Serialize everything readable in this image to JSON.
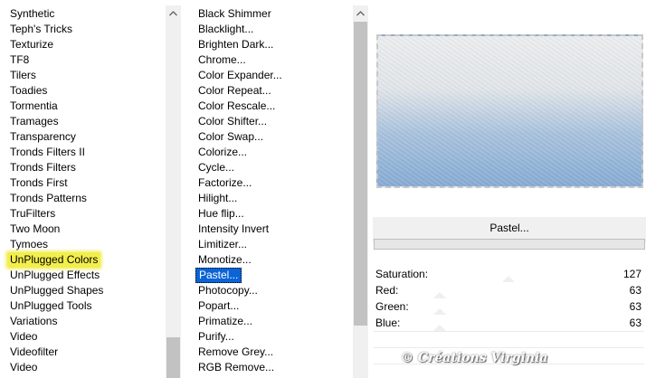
{
  "categories": {
    "items": [
      "Synthetic",
      "Teph's Tricks",
      "Texturize",
      "TF8",
      "Tilers",
      "Toadies",
      "Tormentia",
      "Tramages",
      "Transparency",
      "Tronds Filters II",
      "Tronds Filters",
      "Tronds First",
      "Tronds Patterns",
      "TruFilters",
      "Two Moon",
      "Tymoes",
      "UnPlugged Colors",
      "UnPlugged Effects",
      "UnPlugged Shapes",
      "UnPlugged Tools",
      "Variations",
      "Video",
      "Videofilter",
      "Video"
    ],
    "selected_index": 16
  },
  "filters": {
    "items": [
      "Black Shimmer",
      "Blacklight...",
      "Brighten Dark...",
      "Chrome...",
      "Color Expander...",
      "Color Repeat...",
      "Color Rescale...",
      "Color Shifter...",
      "Color Swap...",
      "Colorize...",
      "Cycle...",
      "Factorize...",
      "Hilight...",
      "Hue flip...",
      "Intensity Invert",
      "Limitizer...",
      "Monotize...",
      "Pastel...",
      "Photocopy...",
      "Popart...",
      "Primatize...",
      "Purify...",
      "Remove Grey...",
      "RGB Remove..."
    ],
    "selected_index": 17
  },
  "preview": {
    "filter_name": "Pastel...",
    "gradient_colors": [
      "#eceeef",
      "#a9c3df",
      "#87acd4"
    ]
  },
  "params": [
    {
      "label": "Saturation:",
      "value": "127"
    },
    {
      "label": "Red:",
      "value": "63"
    },
    {
      "label": "Green:",
      "value": "63"
    },
    {
      "label": "Blue:",
      "value": "63"
    }
  ],
  "watermark": "© Créations Virginia",
  "colors": {
    "highlight": "#f2ee4c",
    "selection": "#0a64d6"
  }
}
